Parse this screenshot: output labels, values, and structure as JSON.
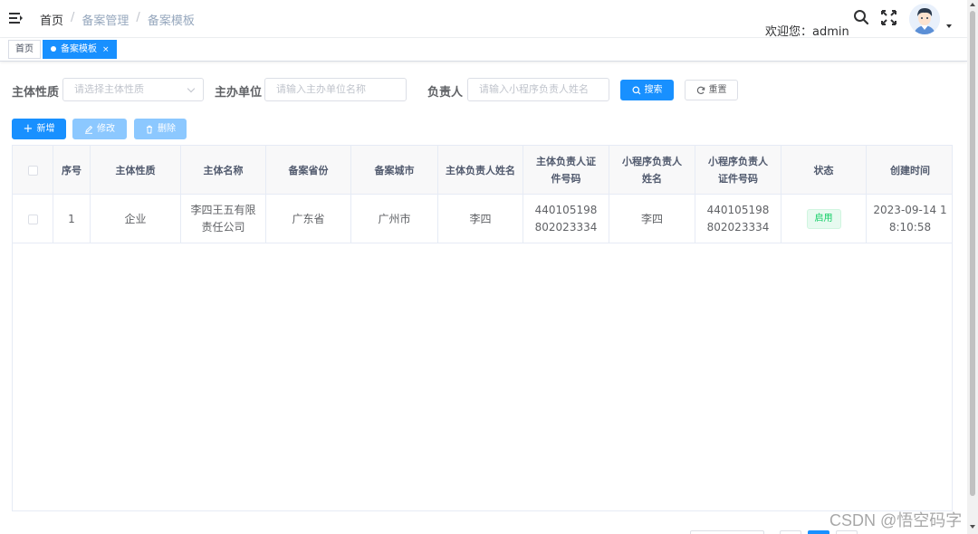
{
  "header": {
    "breadcrumb": [
      "首页",
      "备案管理",
      "备案模板"
    ],
    "breadcrumb_sep": "/",
    "welcome": "欢迎您：admin"
  },
  "tags": [
    {
      "label": "首页",
      "active": false
    },
    {
      "label": "备案模板",
      "active": true,
      "close": "×"
    }
  ],
  "search": {
    "fields": [
      {
        "label": "主体性质",
        "placeholder": "请选择主体性质",
        "type": "select"
      },
      {
        "label": "主办单位",
        "placeholder": "请输入主办单位名称",
        "type": "text"
      },
      {
        "label": "负责人",
        "placeholder": "请输入小程序负责人姓名",
        "type": "text"
      }
    ],
    "search_label": "搜索",
    "reset_label": "重置"
  },
  "toolbar": {
    "add_label": "新增",
    "edit_label": "修改",
    "delete_label": "删除"
  },
  "table": {
    "columns": [
      "",
      "序号",
      "主体性质",
      "主体名称",
      "备案省份",
      "备案城市",
      "主体负责人姓名",
      "主体负责人证件号码",
      "小程序负责人姓名",
      "小程序负责人证件号码",
      "状态",
      "创建时间"
    ],
    "rows": [
      [
        "",
        "1",
        "企业",
        "李四王五有限责任公司",
        "广东省",
        "广州市",
        "李四",
        "440105198802023334",
        "李四",
        "440105198802023334",
        "启用",
        "2023-09-14 18:10:58"
      ]
    ]
  },
  "watermark": "CSDN @悟空码字",
  "colors": {
    "primary": "#1890ff",
    "success": "#13ce66",
    "border": "#e6ebf5"
  }
}
